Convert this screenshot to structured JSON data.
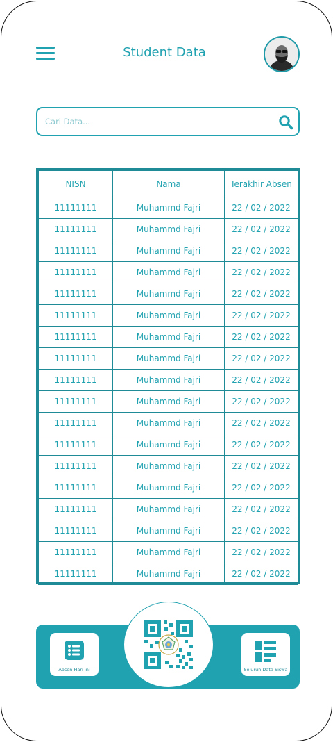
{
  "header": {
    "title": "Student Data"
  },
  "search": {
    "placeholder": "Cari Data..."
  },
  "table": {
    "columns": [
      "NISN",
      "Nama",
      "Terakhir Absen"
    ],
    "rows": [
      [
        "11111111",
        "Muhammd Fajri",
        "22 / 02 / 2022"
      ],
      [
        "11111111",
        "Muhammd Fajri",
        "22 / 02 / 2022"
      ],
      [
        "11111111",
        "Muhammd Fajri",
        "22 / 02 / 2022"
      ],
      [
        "11111111",
        "Muhammd Fajri",
        "22 / 02 / 2022"
      ],
      [
        "11111111",
        "Muhammd Fajri",
        "22 / 02 / 2022"
      ],
      [
        "11111111",
        "Muhammd Fajri",
        "22 / 02 / 2022"
      ],
      [
        "11111111",
        "Muhammd Fajri",
        "22 / 02 / 2022"
      ],
      [
        "11111111",
        "Muhammd Fajri",
        "22 / 02 / 2022"
      ],
      [
        "11111111",
        "Muhammd Fajri",
        "22 / 02 / 2022"
      ],
      [
        "11111111",
        "Muhammd Fajri",
        "22 / 02 / 2022"
      ],
      [
        "11111111",
        "Muhammd Fajri",
        "22 / 02 / 2022"
      ],
      [
        "11111111",
        "Muhammd Fajri",
        "22 / 02 / 2022"
      ],
      [
        "11111111",
        "Muhammd Fajri",
        "22 / 02 / 2022"
      ],
      [
        "11111111",
        "Muhammd Fajri",
        "22 / 02 / 2022"
      ],
      [
        "11111111",
        "Muhammd Fajri",
        "22 / 02 / 2022"
      ],
      [
        "11111111",
        "Muhammd Fajri",
        "22 / 02 / 2022"
      ],
      [
        "11111111",
        "Muhammd Fajri",
        "22 / 02 / 2022"
      ],
      [
        "11111111",
        "Muhammd Fajri",
        "22 / 02 / 2022"
      ]
    ]
  },
  "bottom_nav": {
    "left_label": "Absen Hari ini",
    "right_label": "Seluruh Data Siswa"
  },
  "icons": {
    "menu": "hamburger-menu-icon",
    "avatar": "user-avatar",
    "search": "search-icon",
    "left": "list-icon",
    "center": "qr-code-icon",
    "right": "dashboard-icon"
  },
  "colors": {
    "accent": "#21a2b0",
    "border": "#1f8b97"
  }
}
